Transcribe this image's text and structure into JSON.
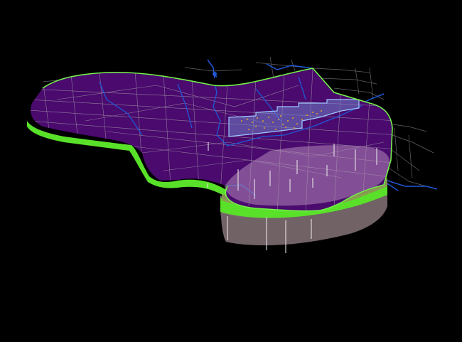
{
  "scene": {
    "background": "#000000",
    "view": "3d-geologic-model",
    "layers": [
      {
        "name": "surface-layer",
        "color": "#4a0a6e"
      },
      {
        "name": "green-layer",
        "color": "#59e12a"
      },
      {
        "name": "cutaway-top",
        "color": "#8a5a90"
      },
      {
        "name": "cutaway-olive",
        "color": "#8c9a52"
      },
      {
        "name": "cutaway-brown",
        "color": "#7a6a6c"
      },
      {
        "name": "highlight-zone",
        "color": "#6f80c8"
      },
      {
        "name": "rivers",
        "color": "#1f58d6"
      },
      {
        "name": "roads",
        "color": "#a9a3a9"
      },
      {
        "name": "outline",
        "color": "#74f04a"
      },
      {
        "name": "points",
        "color": "#e4a22a"
      }
    ]
  }
}
